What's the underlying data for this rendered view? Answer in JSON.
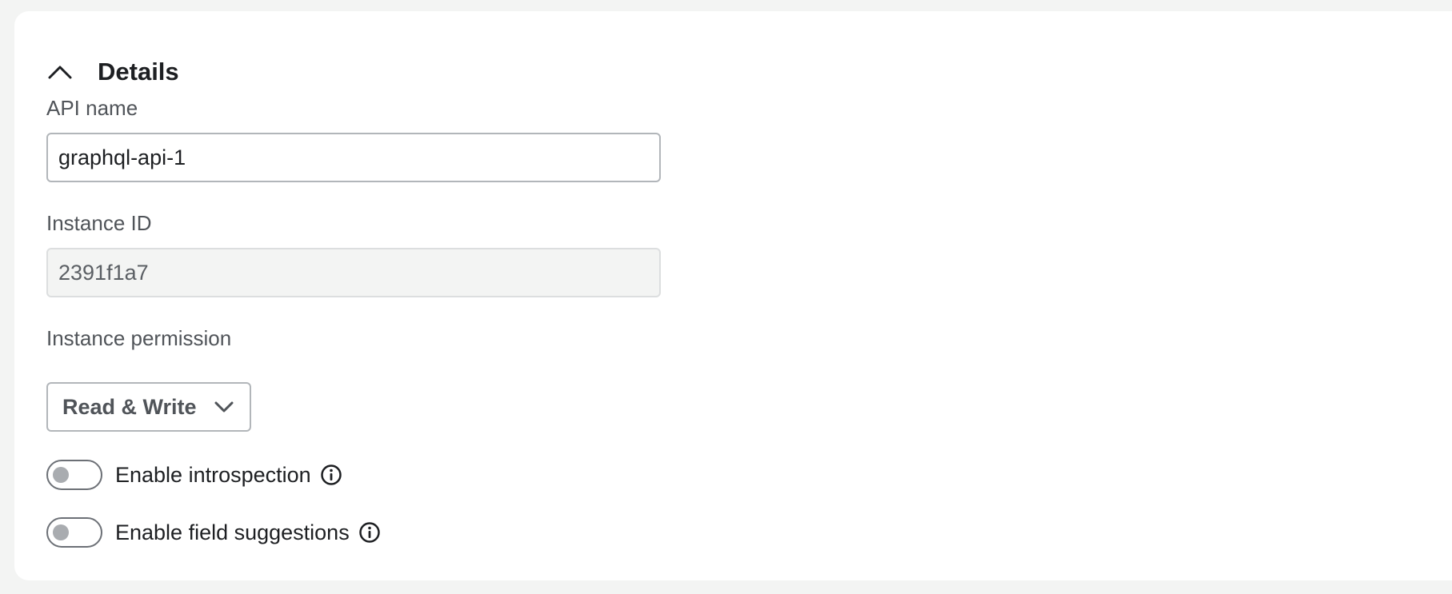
{
  "section": {
    "title": "Details",
    "collapse_icon": "chevron-up-icon",
    "expanded": true
  },
  "fields": {
    "api_name": {
      "label": "API name",
      "value": "graphql-api-1"
    },
    "instance_id": {
      "label": "Instance ID",
      "value": "2391f1a7",
      "readonly": true
    },
    "instance_permission": {
      "label": "Instance permission",
      "selected": "Read & Write",
      "icon": "chevron-down-icon"
    }
  },
  "toggles": {
    "introspection": {
      "label": "Enable introspection",
      "enabled": false,
      "info_icon": "info-icon"
    },
    "field_suggestions": {
      "label": "Enable field suggestions",
      "enabled": false,
      "info_icon": "info-icon"
    }
  },
  "colors": {
    "page_background": "#f3f4f3",
    "panel_background": "#ffffff",
    "input_border": "#b2b6ba",
    "readonly_background": "#f3f4f3",
    "label_text": "#505459",
    "primary_text": "#1d1f22",
    "toggle_knob_off": "#a9acb0"
  }
}
